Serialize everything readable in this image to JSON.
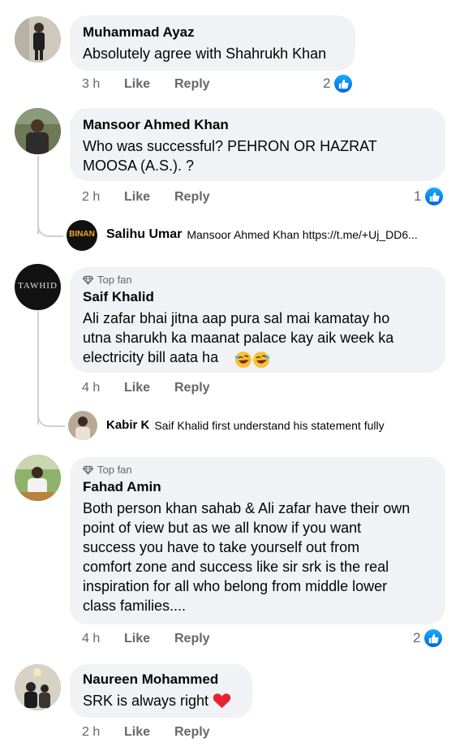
{
  "comments": [
    {
      "name": "Muhammad Ayaz",
      "text": "Absolutely agree with Shahrukh Khan",
      "time": "3 h",
      "like": "Like",
      "reply": "Reply",
      "reaction_count": "2"
    },
    {
      "name": "Mansoor Ahmed Khan",
      "text": "Who was successful? PEHRON OR HAZRAT\nMOOSA (A.S.). ?",
      "time": "2 h",
      "like": "Like",
      "reply": "Reply",
      "reaction_count": "1",
      "replies": [
        {
          "avatar_text": "BINAN",
          "name": "Salihu Umar",
          "text": "Mansoor Ahmed Khan https://t.me/+Uj_DD6..."
        }
      ]
    },
    {
      "badge": "Top fan",
      "name": "Saif Khalid",
      "avatar_text": "TAWHID",
      "text": "Ali zafar bhai jitna aap pura sal mai kamatay ho\nutna sharukh ka maanat palace kay aik week ka\nelectricity bill aata ha",
      "time": "4 h",
      "like": "Like",
      "reply": "Reply",
      "replies": [
        {
          "name": "Kabir K",
          "text": "Saif Khalid first understand his statement fully"
        }
      ]
    },
    {
      "badge": "Top fan",
      "name": "Fahad Amin",
      "text": "Both person khan sahab & Ali zafar have their own\npoint of view but as we all know if you want\nsuccess you have to take yourself out from\ncomfort zone and success like sir srk is the real\ninspiration for all who belong from middle lower\nclass families....",
      "time": "4 h",
      "like": "Like",
      "reply": "Reply",
      "reaction_count": "2"
    },
    {
      "name": "Naureen Mohammed",
      "text": "SRK is always right",
      "time": "2 h",
      "like": "Like",
      "reply": "Reply"
    }
  ],
  "colors": {
    "bubble": "#f0f2f5",
    "meta_text": "#65676b",
    "like_blue": "#0866ff",
    "thread_line": "#ccd0d5"
  },
  "icons": {
    "like": "thumbs-up-icon",
    "top_fan": "diamond-icon",
    "laugh": "rolling-laughing-emoji",
    "heart": "red-heart-emoji"
  }
}
